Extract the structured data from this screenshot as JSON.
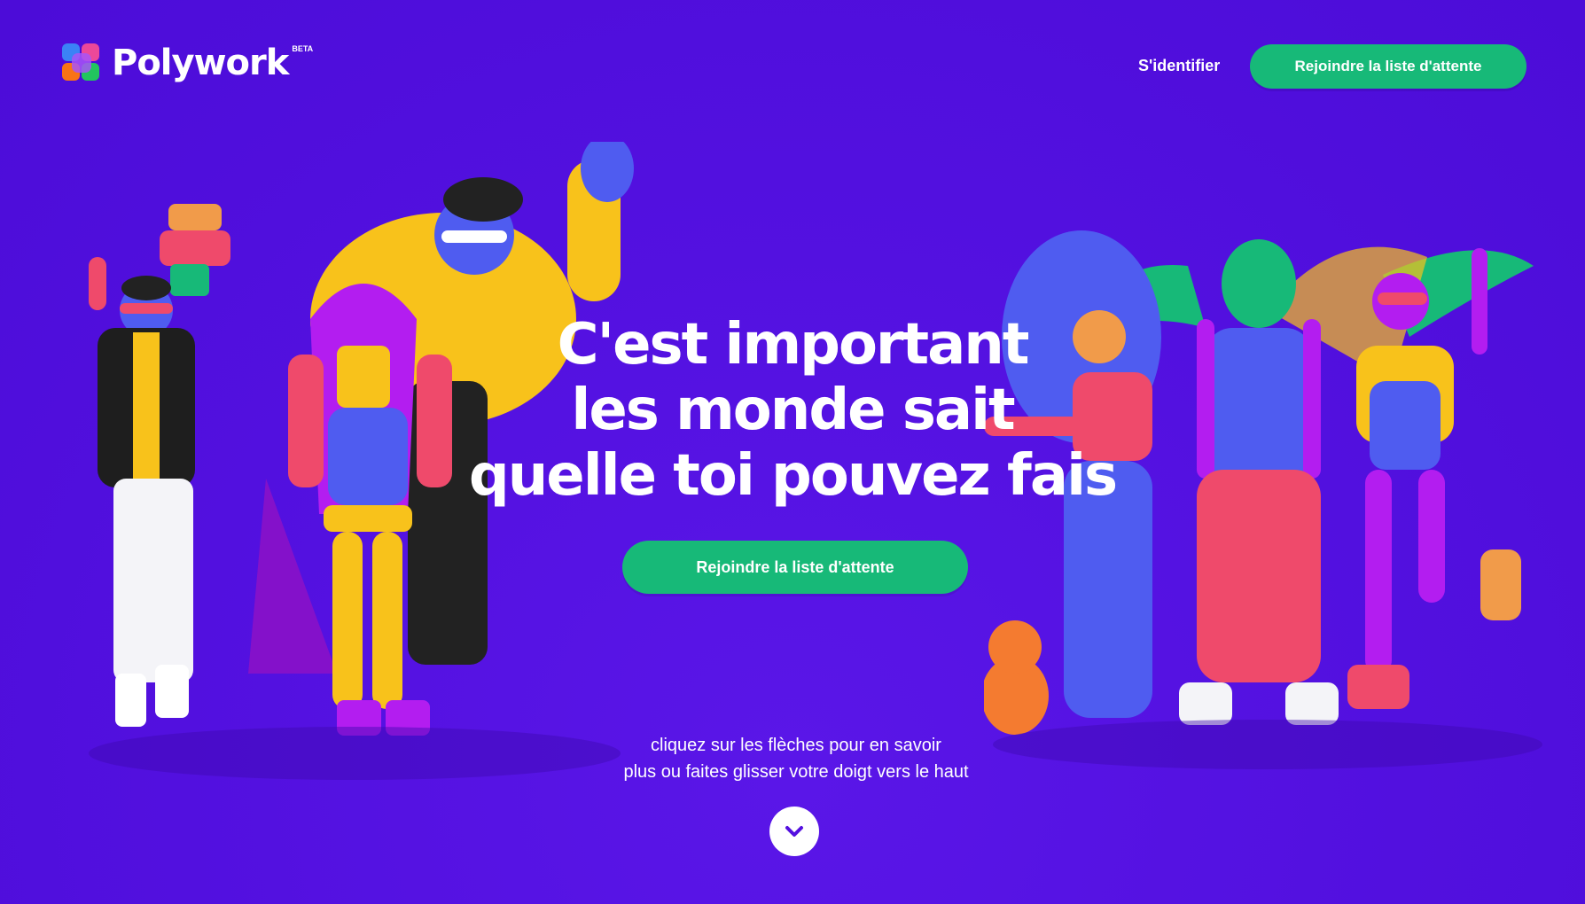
{
  "header": {
    "brand_name": "Polywork",
    "beta_label": "BETA",
    "signin_label": "S'identifier",
    "waitlist_label": "Rejoindre la liste d'attente"
  },
  "hero": {
    "headline_lines": [
      "C'est important",
      "les monde sait",
      "quelle toi pouvez fais"
    ],
    "cta_label": "Rejoindre la liste d'attente",
    "hint_lines": [
      "cliquez sur les flèches pour en savoir",
      "plus ou faites glisser votre doigt vers le haut"
    ]
  },
  "colors": {
    "background": "#5410e0",
    "cta_green": "#17b978",
    "text": "#ffffff"
  },
  "icons": {
    "scroll": "chevron-down-icon",
    "logo": "polywork-logo-icon"
  }
}
